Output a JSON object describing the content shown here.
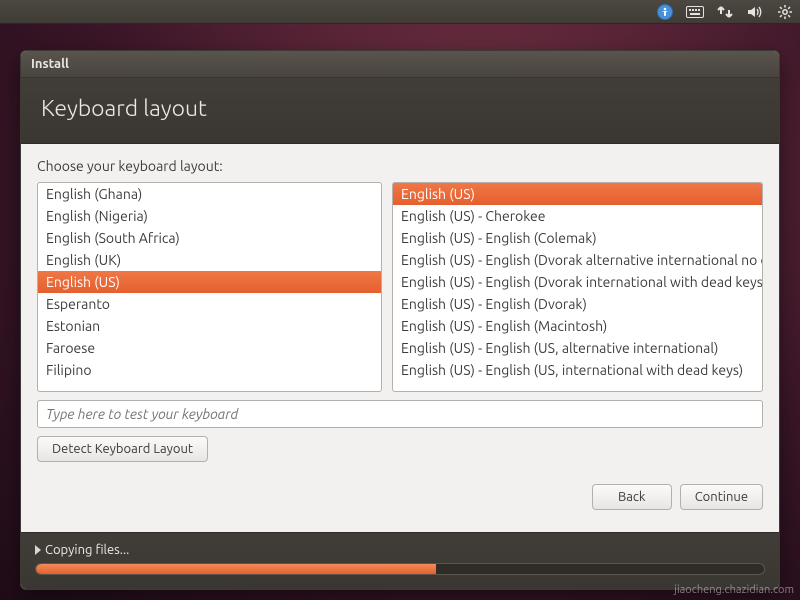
{
  "menubar": {
    "icons": [
      "accessibility",
      "keyboard",
      "network",
      "volume",
      "settings"
    ]
  },
  "window": {
    "title": "Install",
    "heading": "Keyboard layout"
  },
  "prompt": "Choose your keyboard layout:",
  "left_list": {
    "items": [
      "English (Ghana)",
      "English (Nigeria)",
      "English (South Africa)",
      "English (UK)",
      "English (US)",
      "Esperanto",
      "Estonian",
      "Faroese",
      "Filipino"
    ],
    "selected_index": 4
  },
  "right_list": {
    "items": [
      "English (US)",
      "English (US) - Cherokee",
      "English (US) - English (Colemak)",
      "English (US) - English (Dvorak alternative international no dead keys)",
      "English (US) - English (Dvorak international with dead keys)",
      "English (US) - English (Dvorak)",
      "English (US) - English (Macintosh)",
      "English (US) - English (US, alternative international)",
      "English (US) - English (US, international with dead keys)"
    ],
    "selected_index": 0
  },
  "test_input": {
    "placeholder": "Type here to test your keyboard",
    "value": ""
  },
  "buttons": {
    "detect": "Detect Keyboard Layout",
    "back": "Back",
    "continue": "Continue"
  },
  "footer": {
    "status": "Copying files...",
    "progress_percent": 55
  },
  "watermark": "jiaocheng.chazidian.com"
}
